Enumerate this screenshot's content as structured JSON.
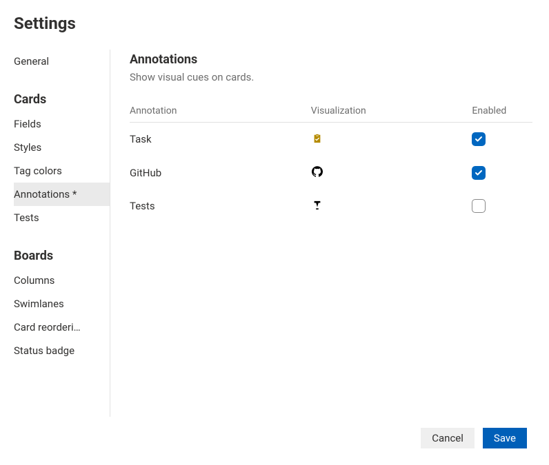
{
  "pageTitle": "Settings",
  "sidebar": {
    "topItem": "General",
    "groups": [
      {
        "heading": "Cards",
        "items": [
          {
            "label": "Fields",
            "selected": false
          },
          {
            "label": "Styles",
            "selected": false
          },
          {
            "label": "Tag colors",
            "selected": false
          },
          {
            "label": "Annotations *",
            "selected": true
          },
          {
            "label": "Tests",
            "selected": false
          }
        ]
      },
      {
        "heading": "Boards",
        "items": [
          {
            "label": "Columns",
            "selected": false
          },
          {
            "label": "Swimlanes",
            "selected": false
          },
          {
            "label": "Card reorderi…",
            "selected": false
          },
          {
            "label": "Status badge",
            "selected": false
          }
        ]
      }
    ]
  },
  "main": {
    "title": "Annotations",
    "subtitle": "Show visual cues on cards.",
    "columns": [
      "Annotation",
      "Visualization",
      "Enabled"
    ],
    "rows": [
      {
        "name": "Task",
        "icon": "task",
        "enabled": true
      },
      {
        "name": "GitHub",
        "icon": "github",
        "enabled": true
      },
      {
        "name": "Tests",
        "icon": "tests",
        "enabled": false
      }
    ]
  },
  "footer": {
    "cancel": "Cancel",
    "save": "Save"
  }
}
